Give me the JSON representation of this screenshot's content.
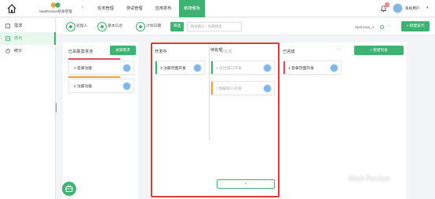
{
  "app": {
    "logo_text": "MadPecker研发管理"
  },
  "nav": {
    "items": [
      "任务管理",
      "测试管理",
      "应用发布",
      "敏捷看板"
    ],
    "active_index": 3
  },
  "header": {
    "notification_count": "12",
    "user_name": "系统用户"
  },
  "sidebar": {
    "items": [
      "需求",
      "迭代",
      "统计"
    ],
    "active_index": 1
  },
  "toolbar": {
    "assignee_label": "处理人",
    "basic_info_label": "基本信息",
    "plan_date_label": "计划日期",
    "filter_button": "筛选",
    "search_placeholder": "搜索编号、标题搜索",
    "sprint_label": "Sprint.No_1",
    "more": "···",
    "new_iteration_button": "+ 新建迭代"
  },
  "columns": {
    "linked": {
      "title": "已关联需求池",
      "button": "关联需求",
      "cards": [
        {
          "text": "1 登录功能",
          "stripe_color": "#e0505c"
        },
        {
          "text": "2 注册功能",
          "stripe_color": "#f0a030"
        }
      ]
    },
    "in_progress": {
      "title": "开发中",
      "cards": [
        {
          "text": "3 注册页面开发",
          "bar_color": "#3cb371"
        }
      ]
    },
    "todo": {
      "title": "待处理",
      "title_hint": "待处理",
      "cards": [
        {
          "text": "4 后台接口开发",
          "bar_color": "#3cb371"
        },
        {
          "text": "7 数据接口开发",
          "bar_color": "#f0a030"
        }
      ],
      "add_label": "+"
    },
    "done": {
      "title": "已完成",
      "more": "···",
      "button": "+ 新建列表",
      "cards": [
        {
          "text": "1 登录页面开发",
          "bar_color": "#e0505c"
        }
      ]
    }
  },
  "colors": {
    "accent": "#3cb371",
    "highlight_border": "#e53935"
  },
  "watermark": {
    "text": "Mad Pecker"
  }
}
